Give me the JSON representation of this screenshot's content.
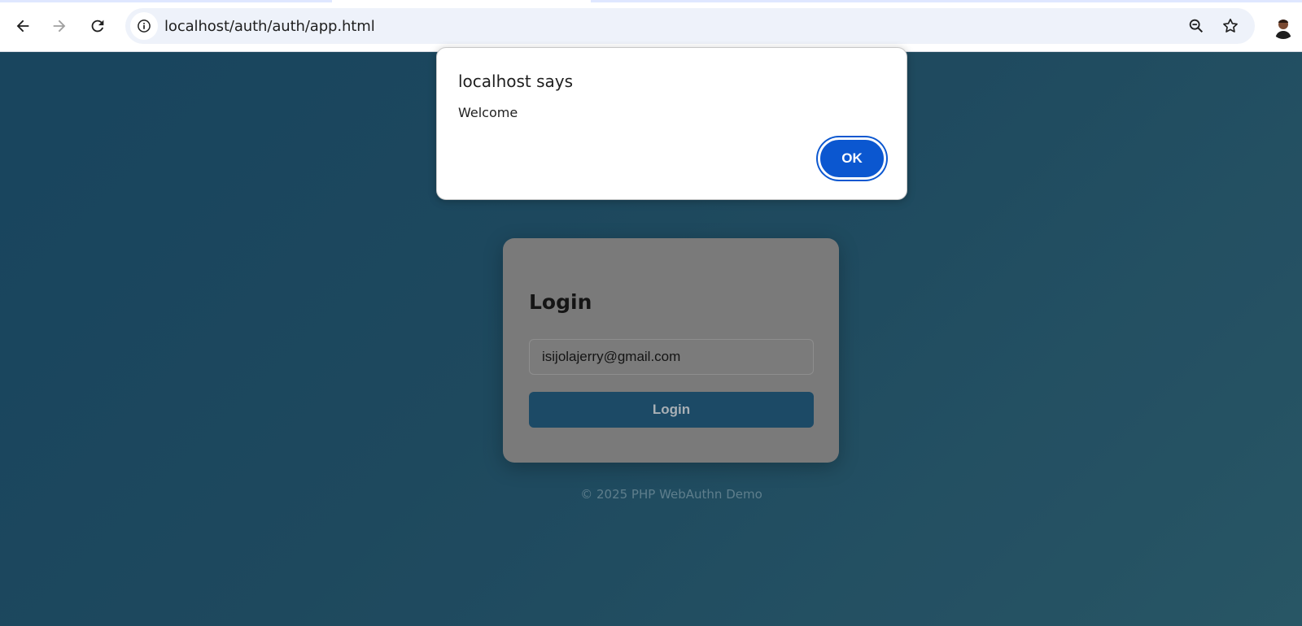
{
  "browser": {
    "url": "localhost/auth/auth/app.html",
    "icons": {
      "back": "back-arrow-icon",
      "forward": "forward-arrow-icon",
      "reload": "reload-icon",
      "site_info": "info-icon",
      "zoom": "zoom-out-icon",
      "bookmark": "star-icon",
      "profile": "avatar"
    }
  },
  "dialog": {
    "title": "localhost says",
    "message": "Welcome",
    "ok_label": "OK"
  },
  "login": {
    "title": "Login",
    "email_value": "isijolajerry@gmail.com",
    "button_label": "Login"
  },
  "footer": {
    "text": "© 2025 PHP WebAuthn Demo"
  },
  "colors": {
    "accent": "#0b57d0",
    "page_background": "#1a4a65",
    "login_button": "#1c4a66"
  }
}
